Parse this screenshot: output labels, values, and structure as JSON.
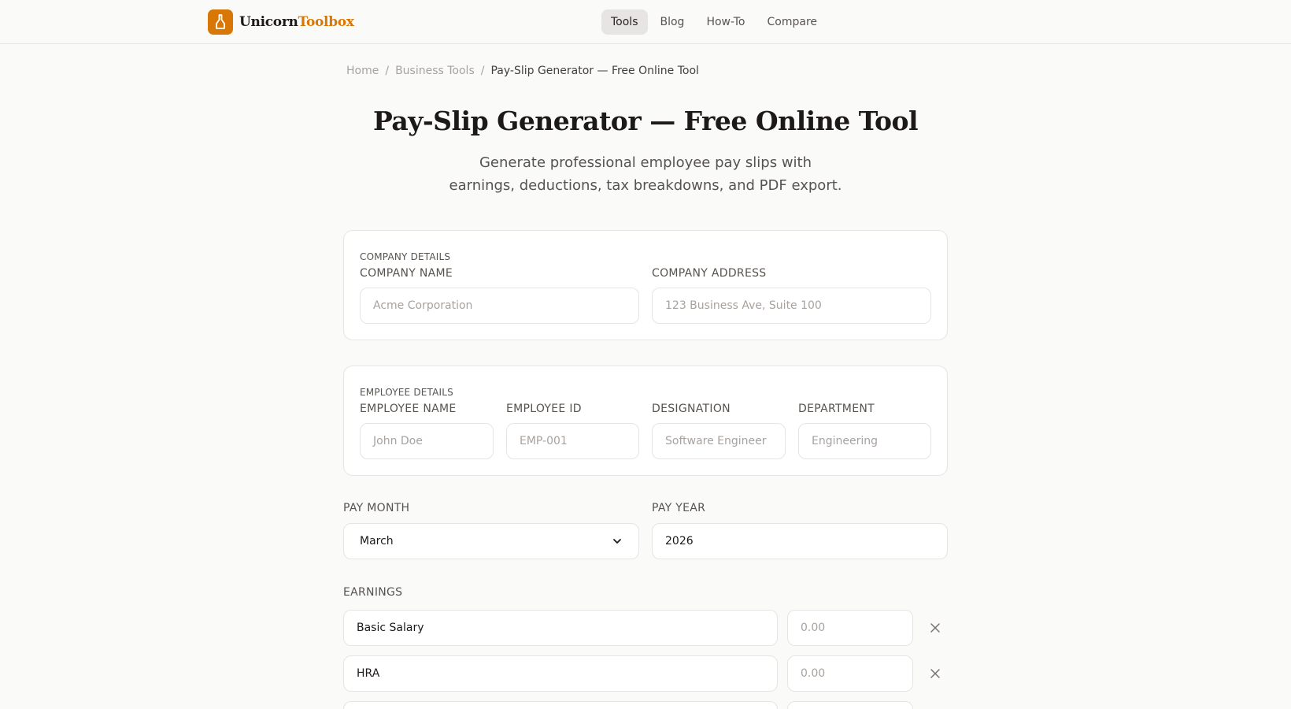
{
  "header": {
    "logo_part1": "Unicorn",
    "logo_part2": "Toolbox",
    "nav": [
      {
        "label": "Tools",
        "active": true
      },
      {
        "label": "Blog"
      },
      {
        "label": "How-To"
      },
      {
        "label": "Compare"
      }
    ]
  },
  "breadcrumb": {
    "items": [
      "Home",
      "Business Tools",
      "Pay-Slip Generator — Free Online Tool"
    ],
    "separator": "/"
  },
  "page": {
    "title": "Pay-Slip Generator — Free Online Tool",
    "subtitle": "Generate professional employee pay slips with earnings, deductions, tax breakdowns, and PDF export."
  },
  "company": {
    "section_label": "COMPANY DETAILS",
    "name_label": "COMPANY NAME",
    "name_placeholder": "Acme Corporation",
    "address_label": "COMPANY ADDRESS",
    "address_placeholder": "123 Business Ave, Suite 100"
  },
  "employee": {
    "section_label": "EMPLOYEE DETAILS",
    "fields": [
      {
        "label": "EMPLOYEE NAME",
        "placeholder": "John Doe"
      },
      {
        "label": "EMPLOYEE ID",
        "placeholder": "EMP-001"
      },
      {
        "label": "DESIGNATION",
        "placeholder": "Software Engineer"
      },
      {
        "label": "DEPARTMENT",
        "placeholder": "Engineering"
      }
    ]
  },
  "pay_period": {
    "month_label": "PAY MONTH",
    "month_value": "March",
    "year_label": "PAY YEAR",
    "year_value": "2026"
  },
  "earnings": {
    "section_label": "EARNINGS",
    "rows": [
      {
        "name": "Basic Salary",
        "amount_placeholder": "0.00"
      },
      {
        "name": "HRA",
        "amount_placeholder": "0.00"
      }
    ]
  },
  "colors": {
    "accent": "#d97706",
    "background": "#fafaf9",
    "border": "#e7e5e4"
  }
}
